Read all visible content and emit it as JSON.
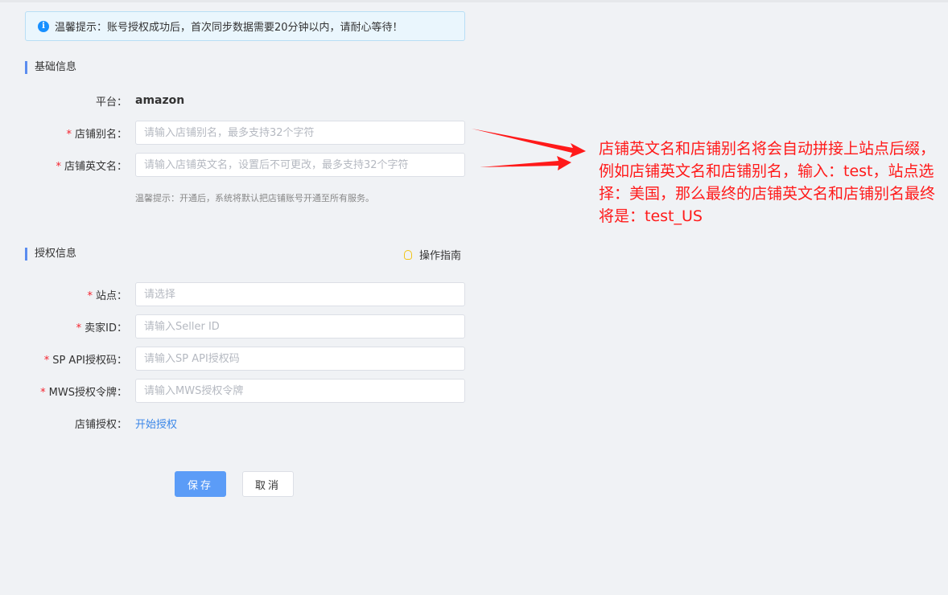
{
  "notice": {
    "icon": "info-icon",
    "text": "温馨提示：账号授权成功后，首次同步数据需要20分钟以内，请耐心等待！"
  },
  "basic": {
    "title": "基础信息",
    "platform_label": "平台：",
    "platform_value": "amazon",
    "alias_label": "店铺别名：",
    "alias_placeholder": "请输入店铺别名，最多支持32个字符",
    "en_label": "店铺英文名：",
    "en_placeholder": "请输入店铺英文名，设置后不可更改，最多支持32个字符",
    "hint": "温馨提示：开通后，系统将默认把店铺账号开通至所有服务。"
  },
  "auth": {
    "title": "授权信息",
    "guide_label": "操作指南",
    "site_label": "站点：",
    "site_placeholder": "请选择",
    "seller_label": "卖家ID：",
    "seller_placeholder": "请输入Seller ID",
    "sp_label": "SP API授权码：",
    "sp_placeholder": "请输入SP API授权码",
    "mws_label": "MWS授权令牌：",
    "mws_placeholder": "请输入MWS授权令牌",
    "store_auth_label": "店铺授权：",
    "store_auth_link": "开始授权"
  },
  "actions": {
    "save": "保存",
    "cancel": "取消"
  },
  "required_mark": "*",
  "annotation": "店铺英文名和店铺别名将会自动拼接上站点后缀，例如店铺英文名和店铺别名，输入：test，站点选择：美国，那么最终的店铺英文名和店铺别名最终将是：test_US",
  "colors": {
    "accent": "#5b9cf7",
    "link": "#3b87e8",
    "required": "#f5222d",
    "annotation": "#ff1a1a"
  }
}
